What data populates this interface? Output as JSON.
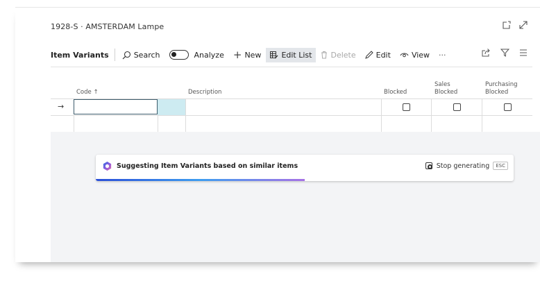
{
  "page": {
    "title": "1928-S · AMSTERDAM Lampe"
  },
  "toolbar": {
    "title": "Item Variants",
    "search": "Search",
    "analyze": "Analyze",
    "new": "New",
    "edit_list": "Edit List",
    "delete": "Delete",
    "edit": "Edit",
    "view": "View",
    "more": "···"
  },
  "table": {
    "columns": {
      "code": "Code ↑",
      "description": "Description",
      "blocked": "Blocked",
      "sales_blocked_1": "Sales",
      "sales_blocked_2": "Blocked",
      "purchasing_blocked_1": "Purchasing",
      "purchasing_blocked_2": "Blocked"
    },
    "row_marker": "→"
  },
  "copilot": {
    "message": "Suggesting Item Variants based on similar items",
    "stop_label": "Stop generating",
    "esc_label": "ESC",
    "progress": 0.5
  },
  "colors": {
    "accent": "#3c5b6b",
    "highlight": "#cdebf1",
    "progress_start": "#2b4fd8",
    "progress_end": "#a772e5"
  }
}
